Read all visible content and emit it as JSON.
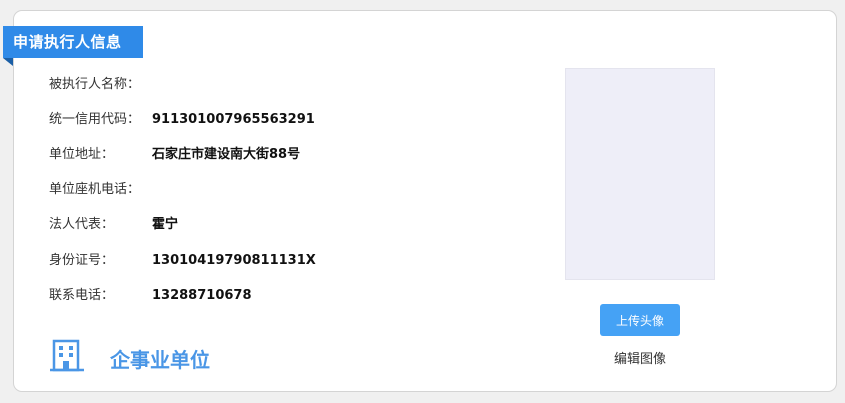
{
  "section": {
    "title": "申请执行人信息"
  },
  "fields": [
    {
      "label": "被执行人名称：",
      "value": ""
    },
    {
      "label": "统一信用代码：",
      "value": "911301007965563291"
    },
    {
      "label": "单位地址：",
      "value": "石家庄市建设南大街88号"
    },
    {
      "label": "单位座机电话：",
      "value": ""
    },
    {
      "label": "法人代表：",
      "value": "霍宁"
    },
    {
      "label": "身份证号：",
      "value": "13010419790811131X"
    },
    {
      "label": "联系电话：",
      "value": "13288710678"
    }
  ],
  "org_type": {
    "label": "企事业单位",
    "icon": "building-icon"
  },
  "avatar": {
    "upload_label": "上传头像",
    "edit_label": "编辑图像"
  },
  "colors": {
    "ribbon": "#2f8ae8",
    "ribbon_fold": "#1b5fa6",
    "accent_text": "#4a96e6",
    "button": "#45a2f5",
    "avatar_bg": "#eeeef8"
  }
}
